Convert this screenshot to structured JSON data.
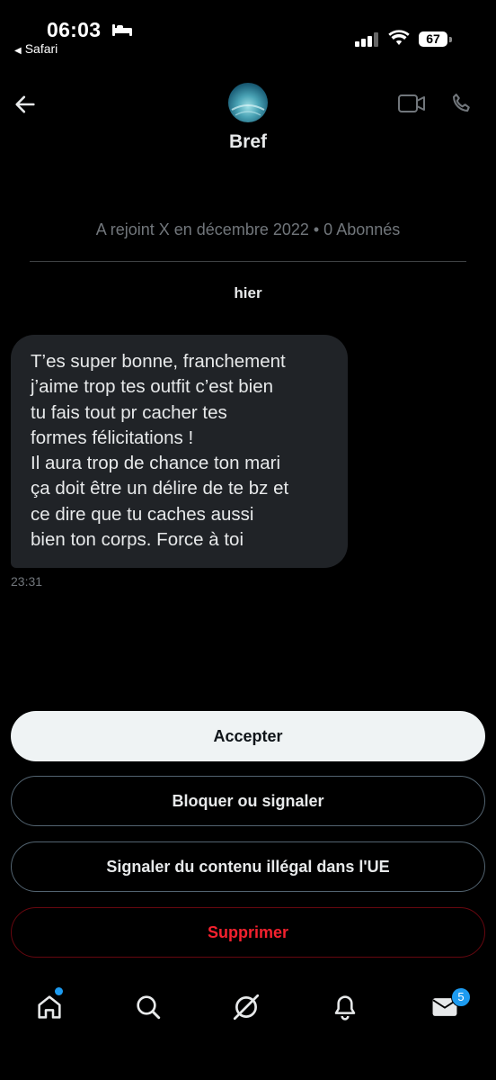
{
  "status_bar": {
    "time": "06:03",
    "back_app": "Safari",
    "battery": "67"
  },
  "header": {
    "contact_name": "Bref",
    "joined_info": "A rejoint X en décembre 2022 • 0 Abonnés"
  },
  "conversation": {
    "day_label": "hier",
    "messages": [
      {
        "text": "T’es super bonne, franchement\nj’aime trop tes outfit c’est bien\ntu fais tout pr cacher tes\nformes félicitations !\nIl aura trop de chance ton mari\nça doit être un délire de te bz et\nce dire que tu caches aussi\nbien ton corps. Force à toi",
        "time": "23:31"
      }
    ]
  },
  "actions": {
    "accept": "Accepter",
    "block_report": "Bloquer ou signaler",
    "report_illegal": "Signaler du contenu illégal dans l'UE",
    "delete": "Supprimer"
  },
  "tab_bar": {
    "items": [
      "home-icon",
      "search-icon",
      "grok-icon",
      "notifications-icon",
      "messages-icon"
    ],
    "messages_badge": "5"
  },
  "colors": {
    "accent": "#1d9bf0",
    "danger": "#f4212e",
    "bubble": "#202327",
    "secondary_text": "#71767b"
  }
}
